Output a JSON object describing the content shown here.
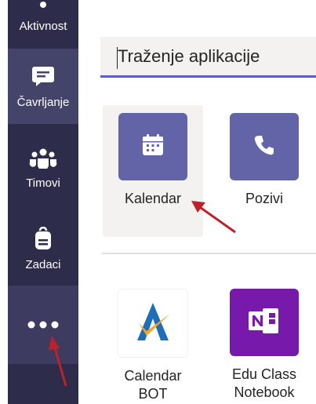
{
  "rail": {
    "items": [
      {
        "name": "activity",
        "label": "Aktivnost"
      },
      {
        "name": "chat",
        "label": "Čavrljanje"
      },
      {
        "name": "teams",
        "label": "Timovi"
      },
      {
        "name": "assignments",
        "label": "Zadaci"
      },
      {
        "name": "more",
        "label": ""
      }
    ]
  },
  "search": {
    "placeholder": "Traženje aplikacije"
  },
  "apps": [
    {
      "name": "calendar",
      "label": "Kalendar",
      "color": "#6264a7",
      "icon": "calendar-icon"
    },
    {
      "name": "calls",
      "label": "Pozivi",
      "color": "#6264a7",
      "icon": "phone-icon"
    },
    {
      "name": "calendar-bot",
      "label_line1": "Calendar",
      "label_line2": "BOT",
      "icon": "calendar-bot-logo"
    },
    {
      "name": "edu-class-notebook",
      "label_line1": "Edu Class",
      "label_line2": "Notebook",
      "color": "#7719aa",
      "icon": "onenote-icon"
    }
  ],
  "colors": {
    "rail_bg": "#2d2c4a",
    "accent": "#6264a7",
    "annotation_arrow": "#c0202a"
  }
}
